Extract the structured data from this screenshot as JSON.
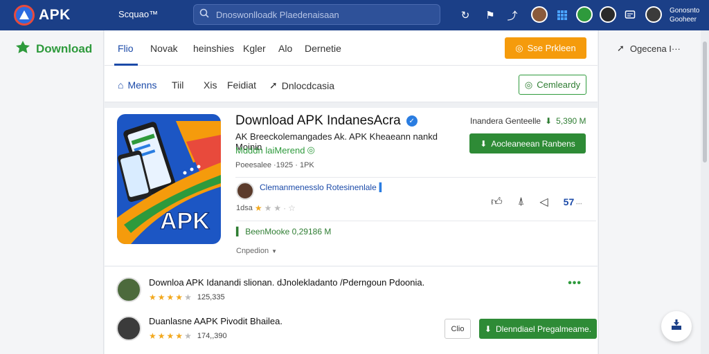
{
  "header": {
    "logo_text": "APK",
    "brand_sub": "Scquao™",
    "search_placeholder": "Dnoswonlloadk Plaedenaisaan",
    "user_line1": "Gonosnto",
    "user_line2": "Gooheer"
  },
  "left": {
    "download_label": "Download"
  },
  "right": {
    "user_label": "Ogecena I···"
  },
  "tabs": [
    "Flio",
    "Novak",
    "heinshies",
    "Kgler",
    "Alo",
    "Dernetie"
  ],
  "save_button": "Sse Prkleen",
  "subnav": {
    "items": [
      "Menns",
      "Tiil",
      "Xis",
      "Feidiat",
      "Dnlocdcasia"
    ],
    "community_button": "Cemleardy"
  },
  "app": {
    "title": "Download APK IndanesAcra",
    "desc_line1": "AK Breeckolemangades Ak. APK Kheaeann nankd Moinin",
    "desc_line2": "Mdddn laiMerend",
    "meta": "Poeesalee ·1925 · 1PK",
    "size_prefix": "Inandera Genteelle",
    "size_value": "5,390 M",
    "download_button": "Aocleaneean Ranbens",
    "developer": "Clemanmenesslo Rotesinenlale",
    "rating_text": "1dsa",
    "rating_stars": 1,
    "likes": "57",
    "downloads": "BeenMooke 0,29186 M",
    "category": "Cnpedion"
  },
  "reviews": [
    {
      "title": "Downloa APK Idanandi slionan. dJnolekladanto /Pderngoun Pdoonia.",
      "rating": "125,335",
      "stars": 3.5,
      "has_more": true,
      "more": "•••"
    },
    {
      "title": "Duanlasne AAPK Pivodit Bhailea.",
      "rating": "174,,390",
      "stars": 4,
      "small_button": "Clio",
      "green_button": "Dlenndiael Pregalmeame."
    }
  ],
  "colors": {
    "topbar": "#1b3f87",
    "accent_green": "#2e8b36",
    "accent_orange": "#f59b0c",
    "link_blue": "#1b4aa8"
  }
}
